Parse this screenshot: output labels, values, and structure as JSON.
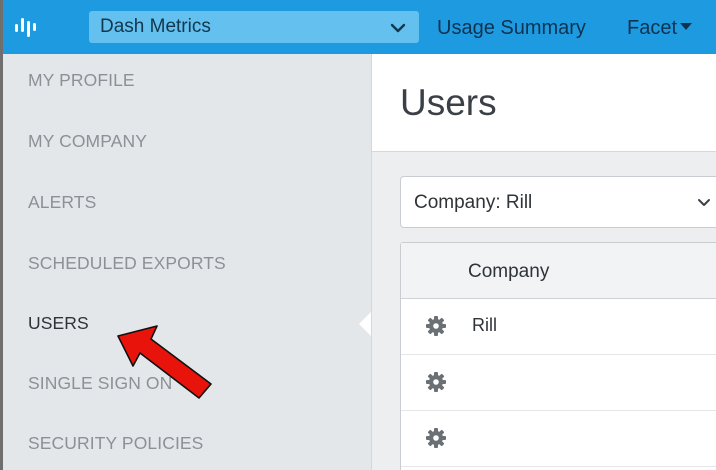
{
  "topbar": {
    "dashboard_select": {
      "value": "Dash Metrics"
    },
    "nav": {
      "usage_summary": "Usage Summary",
      "facet": "Facet"
    }
  },
  "sidebar": {
    "items": [
      {
        "label": "MY PROFILE",
        "active": false
      },
      {
        "label": "MY COMPANY",
        "active": false
      },
      {
        "label": "ALERTS",
        "active": false
      },
      {
        "label": "SCHEDULED EXPORTS",
        "active": false
      },
      {
        "label": "USERS",
        "active": true
      },
      {
        "label": "SINGLE SIGN ON",
        "active": false
      },
      {
        "label": "SECURITY POLICIES",
        "active": false
      }
    ]
  },
  "main": {
    "title": "Users",
    "company_select": {
      "value": "Company: Rill"
    },
    "table": {
      "columns": [
        "Company"
      ],
      "rows": [
        {
          "company": "Rill"
        },
        {
          "company": ""
        },
        {
          "company": ""
        }
      ]
    }
  },
  "colors": {
    "topbar": "#1e9be0",
    "dashboard_select": "#64c0ef",
    "sidebar_bg": "#e4e7ea",
    "annotation_arrow": "#e8140c"
  },
  "icons": {
    "logo": "bars-logo-icon",
    "dropdown": "chevron-down-icon",
    "row_action": "gear-icon",
    "annotation": "red-arrow"
  }
}
